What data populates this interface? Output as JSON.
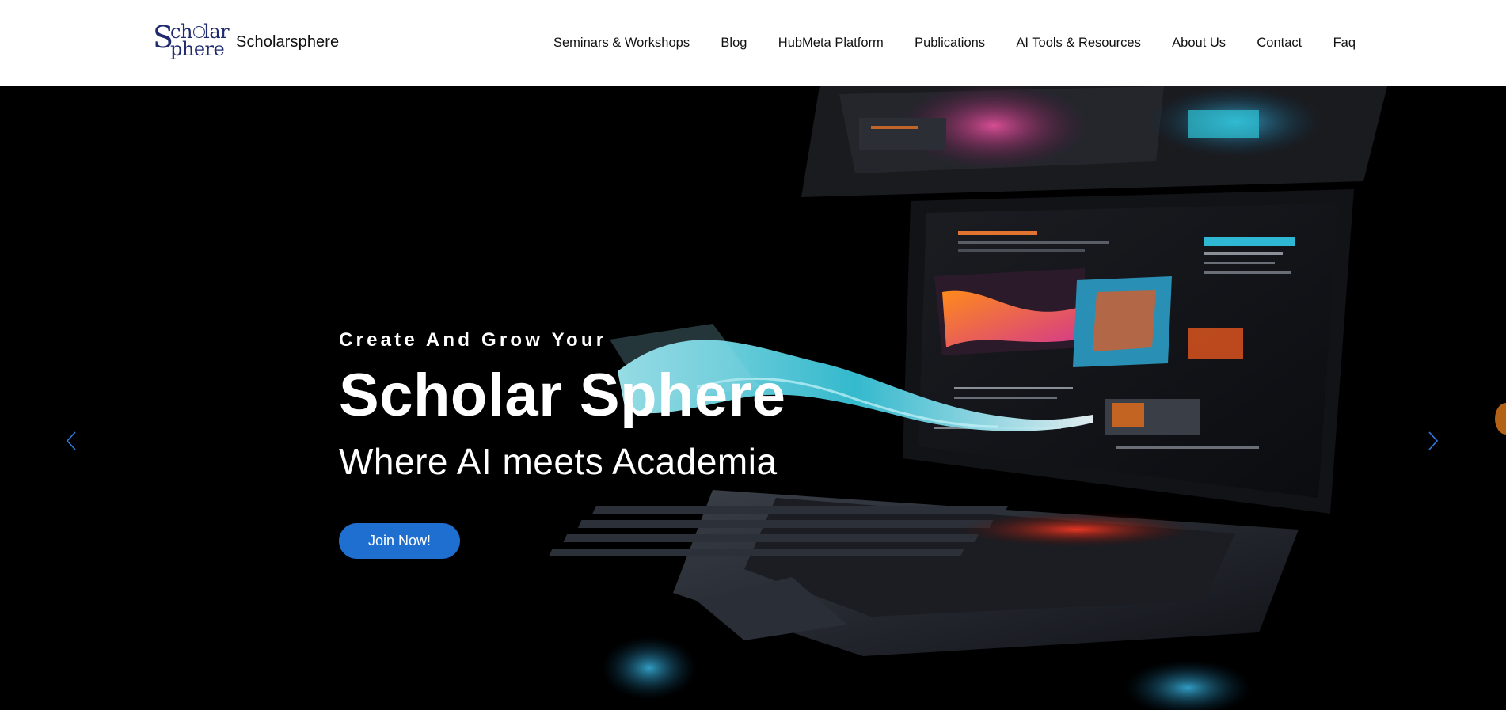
{
  "brand": {
    "logo_text_line1": "ch lar",
    "logo_text_line2": "phere",
    "logo_initial": "S",
    "name": "Scholarsphere"
  },
  "nav": {
    "items": [
      "Seminars & Workshops",
      "Blog",
      "HubMeta Platform",
      "Publications",
      "AI Tools & Resources",
      "About Us",
      "Contact",
      "Faq"
    ]
  },
  "hero": {
    "eyebrow": "Create And Grow Your",
    "title": "Scholar Sphere",
    "subtitle": "Where AI meets Academia",
    "cta_label": "Join Now!",
    "background": "laptop-with-colorful-ai-screens-image",
    "prev_icon": "chevron-left-icon",
    "next_icon": "chevron-right-icon"
  },
  "colors": {
    "header_bg": "#ffffff",
    "logo": "#1f2b6e",
    "cta": "#1f6fd1",
    "arrows": "#2f7ce8",
    "hero_bg": "#000000"
  }
}
